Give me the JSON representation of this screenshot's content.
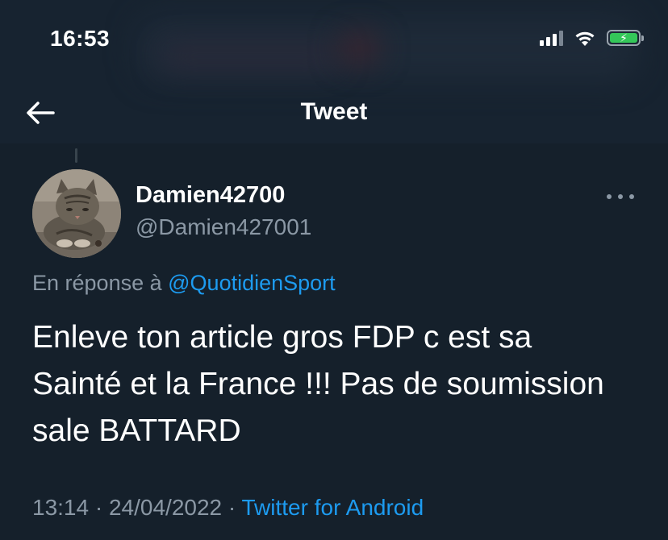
{
  "status_bar": {
    "time": "16:53",
    "battery_charging": true,
    "icons": [
      "signal-icon",
      "wifi-icon",
      "battery-icon"
    ]
  },
  "nav": {
    "back_icon": "arrow-left-icon",
    "title": "Tweet"
  },
  "tweet": {
    "display_name": "Damien42700",
    "handle": "@Damien427001",
    "more_icon": "more-horizontal-icon",
    "reply_prefix": "En réponse à",
    "reply_mention": "@QuotidienSport",
    "text": "Enleve ton article gros FDP c est sa Sainté et la France !!! Pas de soumission sale BATTARD",
    "time": "13:14",
    "separator": "·",
    "date": "24/04/2022",
    "source": "Twitter for Android"
  },
  "colors": {
    "background": "#15202b",
    "text_primary": "#ffffff",
    "text_secondary": "#8b98a5",
    "link": "#1d9bf0",
    "battery": "#34c759"
  }
}
